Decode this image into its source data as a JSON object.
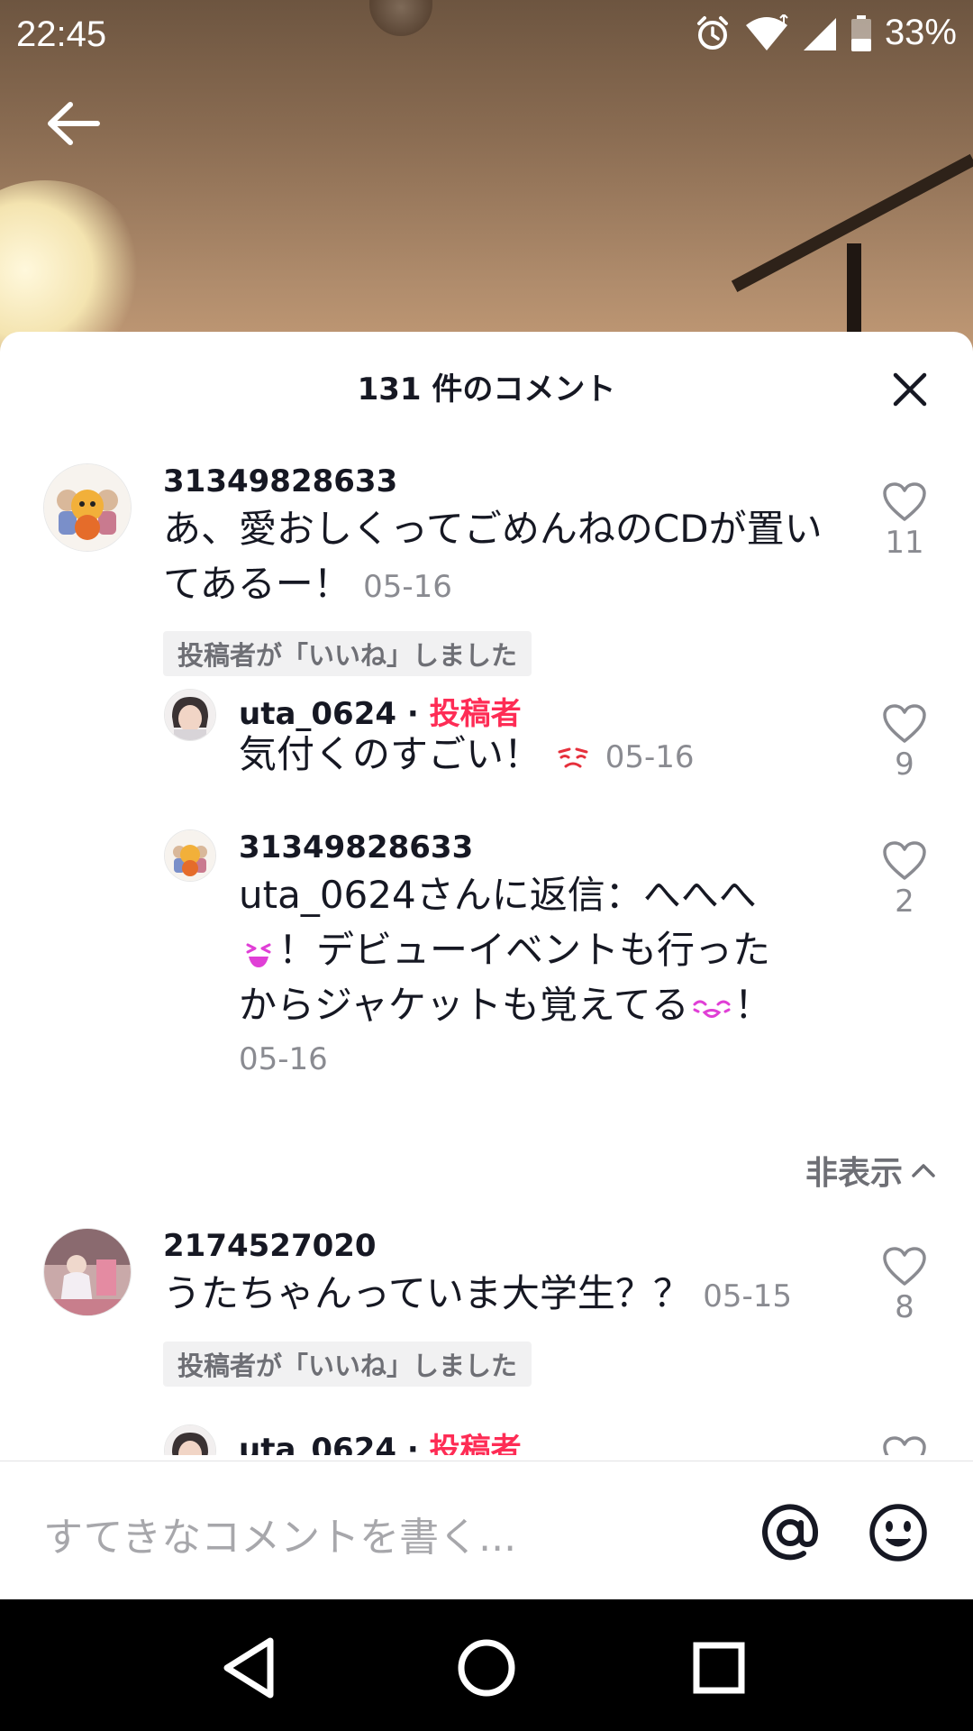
{
  "status_bar": {
    "time": "22:45",
    "battery": "33%"
  },
  "header": {
    "title": "131 件のコメント"
  },
  "comments": [
    {
      "username": "31349828633",
      "text": "あ、愛おしくってごめんねのCDが置いてあるー！",
      "date": "05-16",
      "liked_badge": "投稿者が「いいね」しました",
      "likes": "11",
      "replies": [
        {
          "username": "uta_0624",
          "separator": "·",
          "creator_tag": "投稿者",
          "text": "気付くのすごい！",
          "date": "05-16",
          "likes": "9"
        },
        {
          "username": "31349828633",
          "text_line1": "uta_0624さんに返信：へへへ",
          "text_line2": "！デビューイベントも行った",
          "text_line3": "からジャケットも覚えてる",
          "text_line3_end": "！",
          "date": "05-16",
          "likes": "2"
        }
      ],
      "hide_label": "非表示"
    },
    {
      "username": "2174527020",
      "text": "うたちゃんっていま大学生？？",
      "date": "05-15",
      "liked_badge": "投稿者が「いいね」しました",
      "likes": "8",
      "replies": [
        {
          "username": "uta_0624",
          "separator": "·",
          "creator_tag": "投稿者"
        }
      ]
    }
  ],
  "input": {
    "placeholder": "すてきなコメントを書く..."
  },
  "icons": {
    "back": "back-arrow-icon",
    "close": "close-icon",
    "heart": "heart-outline-icon",
    "mention": "at-sign-icon",
    "emoji": "smiley-icon"
  },
  "colors": {
    "creator_tag": "#fe2c55",
    "text_primary": "#161823",
    "text_secondary": "#8a8b91"
  }
}
